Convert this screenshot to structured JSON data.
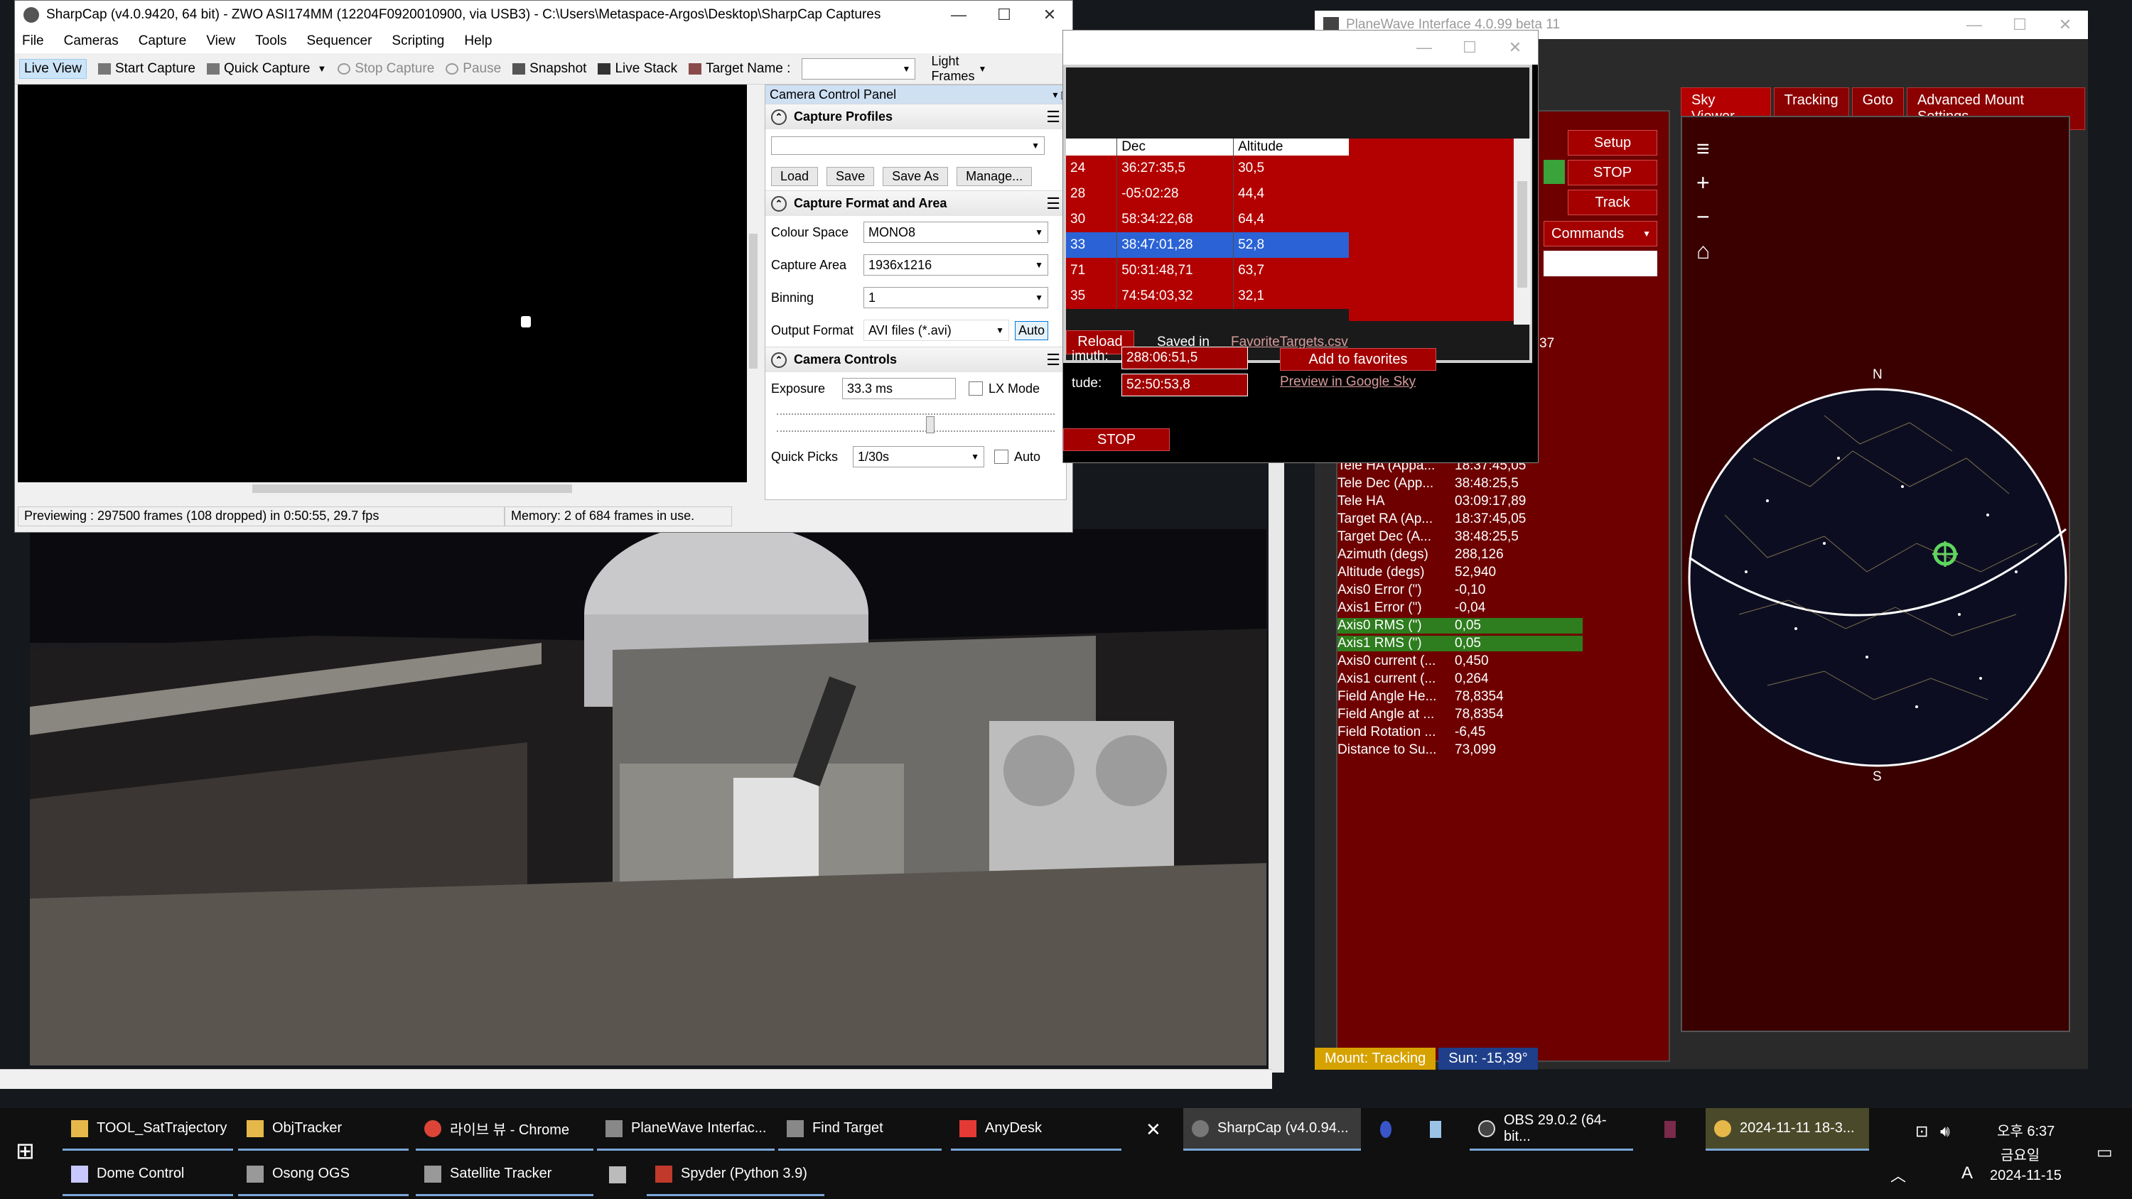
{
  "sharpcap": {
    "title": "SharpCap (v4.0.9420, 64 bit) - ZWO ASI174MM (12204F0920010900, via USB3) - C:\\Users\\Metaspace-Argos\\Desktop\\SharpCap Captures",
    "menu": [
      "File",
      "Cameras",
      "Capture",
      "View",
      "Tools",
      "Sequencer",
      "Scripting",
      "Help"
    ],
    "toolbar": {
      "live_view": "Live View",
      "start_capture": "Start Capture",
      "quick_capture": "Quick Capture",
      "stop_capture": "Stop Capture",
      "pause": "Pause",
      "snapshot": "Snapshot",
      "live_stack": "Live Stack",
      "target_name": "Target Name :",
      "frames": "Light Frames"
    },
    "panel_title": "Camera Control Panel",
    "capture_profiles": {
      "heading": "Capture Profiles",
      "buttons": [
        "Load",
        "Save",
        "Save As",
        "Manage..."
      ]
    },
    "format": {
      "heading": "Capture Format and Area",
      "colour_space_label": "Colour Space",
      "colour_space": "MONO8",
      "capture_area_label": "Capture Area",
      "capture_area": "1936x1216",
      "binning_label": "Binning",
      "binning": "1",
      "output_format_label": "Output Format",
      "output_format": "AVI files (*.avi)",
      "auto": "Auto"
    },
    "controls": {
      "heading": "Camera Controls",
      "exposure_label": "Exposure",
      "exposure": "33.3 ms",
      "lx_mode": "LX Mode",
      "quick_picks_label": "Quick Picks",
      "quick_picks": "1/30s",
      "auto": "Auto"
    },
    "status": {
      "preview": "Previewing : 297500 frames (108 dropped) in 0:50:55, 29.7 fps",
      "memory": "Memory: 2 of 684 frames in use."
    }
  },
  "planewave": {
    "title": "PlaneWave Interface 4.0.99 beta 11",
    "buttons": {
      "setup": "Setup",
      "stop": "STOP",
      "track": "Track",
      "commands": "Commands"
    },
    "tabs": [
      "Sky Viewer",
      "Tracking",
      "Goto",
      "Advanced Mount Settings"
    ],
    "readouts": [
      {
        "k": "Tele HA (Appa...",
        "v": "18:37:45,05"
      },
      {
        "k": "Tele Dec (App...",
        "v": "38:48:25,5"
      },
      {
        "k": "Tele HA",
        "v": "03:09:17,89"
      },
      {
        "k": "Target RA (Ap...",
        "v": "18:37:45,05"
      },
      {
        "k": "Target Dec (A...",
        "v": "38:48:25,5"
      },
      {
        "k": "Azimuth (degs)",
        "v": "288,126"
      },
      {
        "k": "Altitude (degs)",
        "v": "52,940"
      },
      {
        "k": "Axis0 Error (\")",
        "v": "-0,10"
      },
      {
        "k": "Axis1 Error (\")",
        "v": "-0,04"
      },
      {
        "k": "Axis0 RMS (\")",
        "v": "0,05"
      },
      {
        "k": "Axis1 RMS (\")",
        "v": "0,05"
      },
      {
        "k": "Axis0 current (...",
        "v": "0,450"
      },
      {
        "k": "Axis1 current (...",
        "v": "0,264"
      },
      {
        "k": "Field Angle He...",
        "v": "78,8354"
      },
      {
        "k": "Field Angle at ...",
        "v": "78,8354"
      },
      {
        "k": "Field Rotation ...",
        "v": "-6,45"
      },
      {
        "k": "Distance to Su...",
        "v": "73,099"
      }
    ],
    "partial_value": "37",
    "mount_status": "Mount: Tracking",
    "sun": "Sun: -15,39°",
    "compass": {
      "n": "N",
      "s": "S"
    }
  },
  "find_target": {
    "columns": [
      "",
      "Dec",
      "Altitude"
    ],
    "rows": [
      {
        "a": "24",
        "dec": "36:27:35,5",
        "alt": "30,5"
      },
      {
        "a": "28",
        "dec": "-05:02:28",
        "alt": "44,4"
      },
      {
        "a": "30",
        "dec": "58:34:22,68",
        "alt": "64,4"
      },
      {
        "a": "33",
        "dec": "38:47:01,28",
        "alt": "52,8"
      },
      {
        "a": "71",
        "dec": "50:31:48,71",
        "alt": "63,7"
      },
      {
        "a": "35",
        "dec": "74:54:03,32",
        "alt": "32,1"
      }
    ],
    "reload": "Reload",
    "saved_in": "Saved in",
    "saved_file": "FavoriteTargets.csv",
    "azimuth_label": "imuth:",
    "azimuth": "288:06:51,5",
    "altitude_label": "tude:",
    "altitude": "52:50:53,8",
    "add_fav": "Add to favorites",
    "preview_sky": "Preview in Google Sky",
    "stop": "STOP"
  },
  "taskbar": {
    "row1": [
      "TOOL_SatTrajectory",
      "ObjTracker",
      "라이브 뷰 - Chrome",
      "PlaneWave Interfac...",
      "Find Target",
      "AnyDesk",
      "SharpCap (v4.0.94...",
      "OBS 29.0.2 (64-bit...",
      "2024-11-11 18-3..."
    ],
    "row2": [
      "Dome Control",
      "Osong OGS",
      "Satellite Tracker",
      "Spyder (Python 3.9)"
    ],
    "clock_time": "오후 6:37",
    "clock_day": "금요일",
    "clock_date": "2024-11-15",
    "ime": "A"
  }
}
